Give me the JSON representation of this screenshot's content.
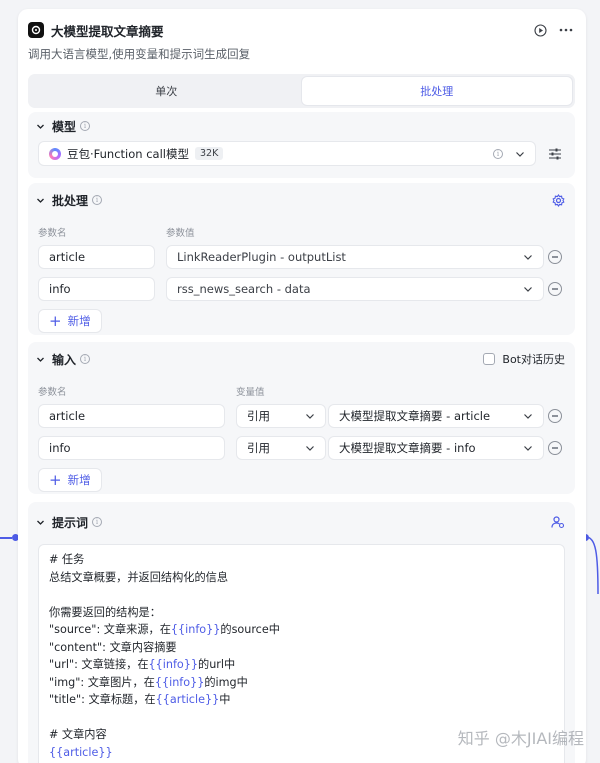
{
  "node": {
    "title": "大模型提取文章摘要",
    "description": "调用大语言模型,使用变量和提示词生成回复"
  },
  "tabs": [
    {
      "label": "单次",
      "active": false
    },
    {
      "label": "批处理",
      "active": true
    }
  ],
  "model_section": {
    "title": "模型",
    "model_name": "豆包·Function call模型",
    "context_badge": "32K"
  },
  "batch_section": {
    "title": "批处理",
    "col_param_name": "参数名",
    "col_param_value": "参数值",
    "rows": [
      {
        "name": "article",
        "value": "LinkReaderPlugin - outputList"
      },
      {
        "name": "info",
        "value": "rss_news_search - data"
      }
    ],
    "add_label": "新增"
  },
  "input_section": {
    "title": "输入",
    "bot_history_label": "Bot对话历史",
    "col_param_name": "参数名",
    "col_var_value": "变量值",
    "rows": [
      {
        "name": "article",
        "type": "引用",
        "value": "大模型提取文章摘要 - article"
      },
      {
        "name": "info",
        "type": "引用",
        "value": "大模型提取文章摘要 - info"
      }
    ],
    "add_label": "新增"
  },
  "prompt_section": {
    "title": "提示词",
    "lines": [
      [
        {
          "t": "# 任务"
        }
      ],
      [
        {
          "t": "总结文章概要，并返回结构化的信息"
        }
      ],
      [
        {
          "t": ""
        }
      ],
      [
        {
          "t": "你需要返回的结构是："
        }
      ],
      [
        {
          "t": "\"source\": 文章来源，在"
        },
        {
          "t": "{{info}}",
          "var": true
        },
        {
          "t": "的source中"
        }
      ],
      [
        {
          "t": "\"content\": 文章内容摘要"
        }
      ],
      [
        {
          "t": "\"url\": 文章链接，在"
        },
        {
          "t": "{{info}}",
          "var": true
        },
        {
          "t": "的url中"
        }
      ],
      [
        {
          "t": "\"img\": 文章图片，在"
        },
        {
          "t": "{{info}}",
          "var": true
        },
        {
          "t": "的img中"
        }
      ],
      [
        {
          "t": "\"title\": 文章标题，在"
        },
        {
          "t": "{{article}}",
          "var": true
        },
        {
          "t": "中"
        }
      ],
      [
        {
          "t": ""
        }
      ],
      [
        {
          "t": "# 文章内容"
        }
      ],
      [
        {
          "t": "{{article}}",
          "var": true
        }
      ]
    ]
  },
  "watermark": "知乎 @木JIAI编程",
  "colors": {
    "accent": "#4e5ce6",
    "section_bg": "#f6f7f9"
  }
}
